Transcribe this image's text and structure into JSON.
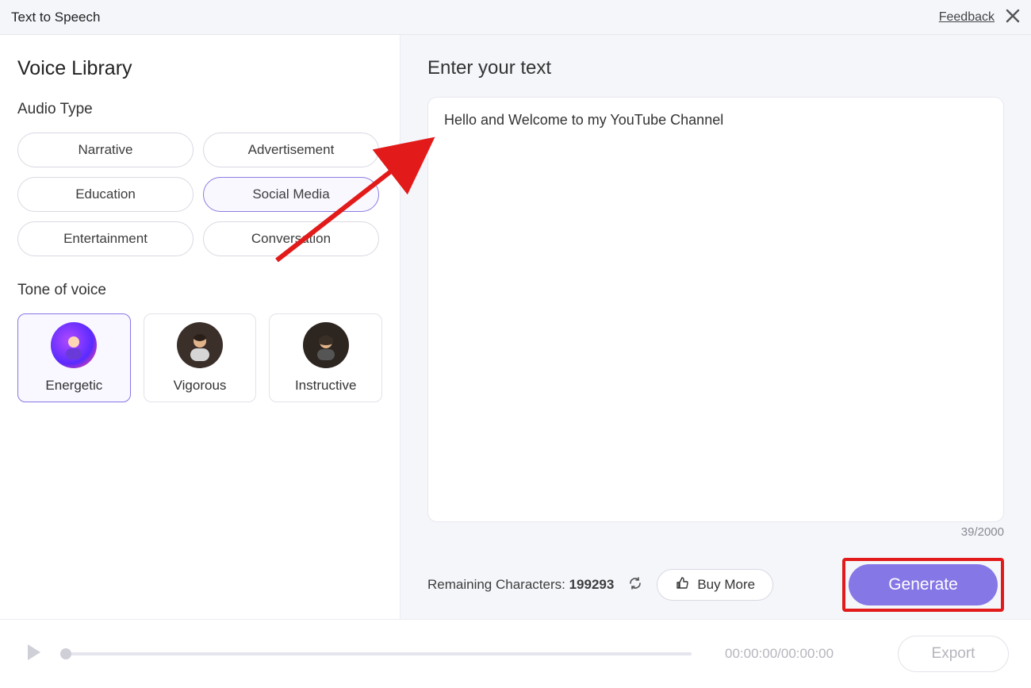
{
  "header": {
    "title": "Text to Speech",
    "feedback": "Feedback"
  },
  "sidebar": {
    "title": "Voice Library",
    "audioTypeLabel": "Audio Type",
    "audioTypes": [
      "Narrative",
      "Advertisement",
      "Education",
      "Social Media",
      "Entertainment",
      "Conversation"
    ],
    "selectedAudioType": "Social Media",
    "toneLabel": "Tone of voice",
    "voices": [
      {
        "name": "Energetic",
        "selected": true
      },
      {
        "name": "Vigorous",
        "selected": false
      },
      {
        "name": "Instructive",
        "selected": false
      }
    ]
  },
  "editor": {
    "heading": "Enter your text",
    "text": "Hello and Welcome to my YouTube Channel",
    "charCount": "39/2000",
    "remainingLabel": "Remaining Characters:",
    "remainingValue": "199293",
    "buyMore": "Buy More",
    "generate": "Generate"
  },
  "player": {
    "timestamp": "00:00:00/00:00:00",
    "export": "Export"
  }
}
